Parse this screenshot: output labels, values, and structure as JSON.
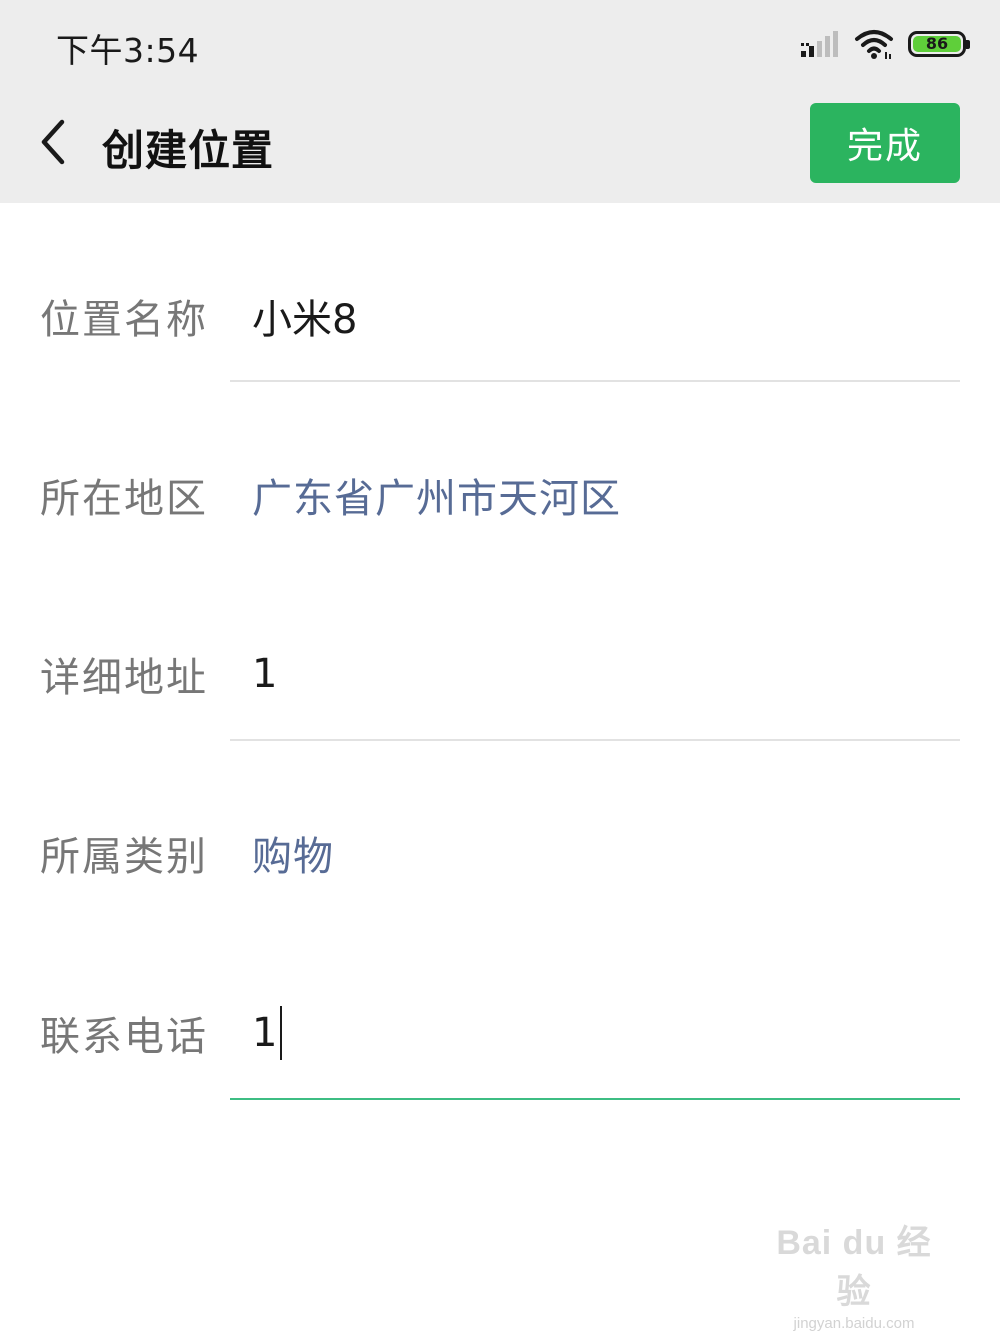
{
  "status_bar": {
    "time": "下午3:54",
    "battery_level": "86",
    "icons": [
      "signal-icon",
      "wifi-icon",
      "battery-icon"
    ]
  },
  "header": {
    "title": "创建位置",
    "done_label": "完成",
    "back_icon": "chevron-left-icon"
  },
  "form": {
    "name": {
      "label": "位置名称",
      "value": "小米8"
    },
    "region": {
      "label": "所在地区",
      "value": "广东省广州市天河区"
    },
    "address": {
      "label": "详细地址",
      "value": "1"
    },
    "category": {
      "label": "所属类别",
      "value": "购物"
    },
    "phone": {
      "label": "联系电话",
      "value": "1"
    }
  },
  "watermark": {
    "main": "Bai du 经验",
    "sub": "jingyan.baidu.com"
  },
  "colors": {
    "accent": "#2bb45f",
    "link": "#576b95",
    "active_line": "#3dbd83",
    "header_bg": "#ededed"
  }
}
